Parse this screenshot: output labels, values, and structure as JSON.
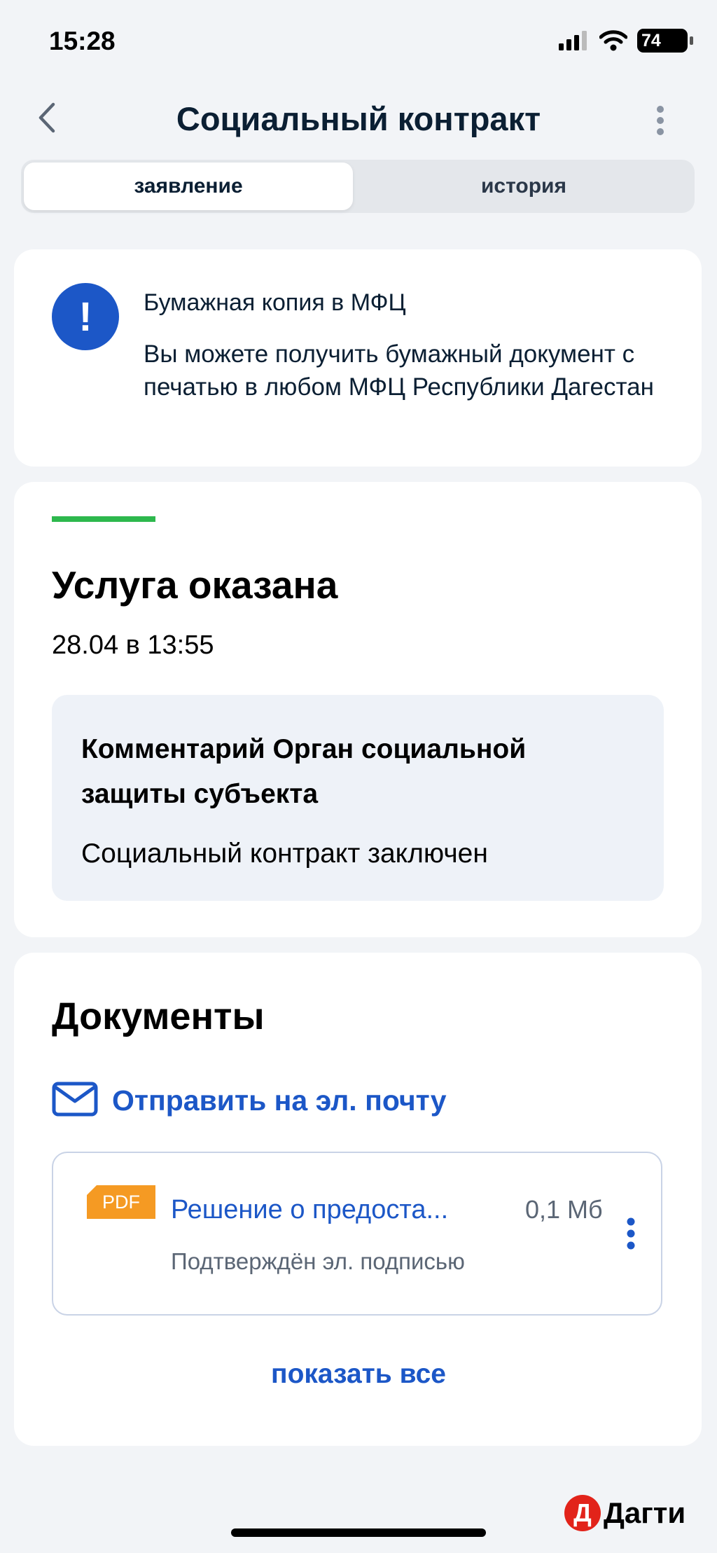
{
  "status_bar": {
    "time": "15:28",
    "battery": "74"
  },
  "header": {
    "title": "Социальный контракт"
  },
  "tabs": [
    {
      "label": "заявление",
      "active": true
    },
    {
      "label": "история",
      "active": false
    }
  ],
  "info_card": {
    "icon": "exclamation-icon",
    "title": "Бумажная копия в МФЦ",
    "text": "Вы можете получить бумажный документ с печатью в любом МФЦ Республики Дагестан"
  },
  "status_card": {
    "title": "Услуга оказана",
    "date": "28.04 в 13:55",
    "comment_title": "Комментарий Орган социальной защиты субъекта",
    "comment_text": "Социальный контракт заключен",
    "accent_color": "#2db84d"
  },
  "documents": {
    "title": "Документы",
    "send_email_label": "Отправить на эл. почту",
    "file": {
      "badge": "PDF",
      "name": "Решение о предоста...",
      "size": "0,1 Мб",
      "subtitle": "Подтверждён эл. подписью"
    },
    "show_all_label": "показать все"
  },
  "watermark": {
    "letter": "Д",
    "text": "Дагти"
  },
  "colors": {
    "brand_blue": "#1c57c7",
    "pdf_orange": "#f59a23",
    "success_green": "#2db84d"
  }
}
